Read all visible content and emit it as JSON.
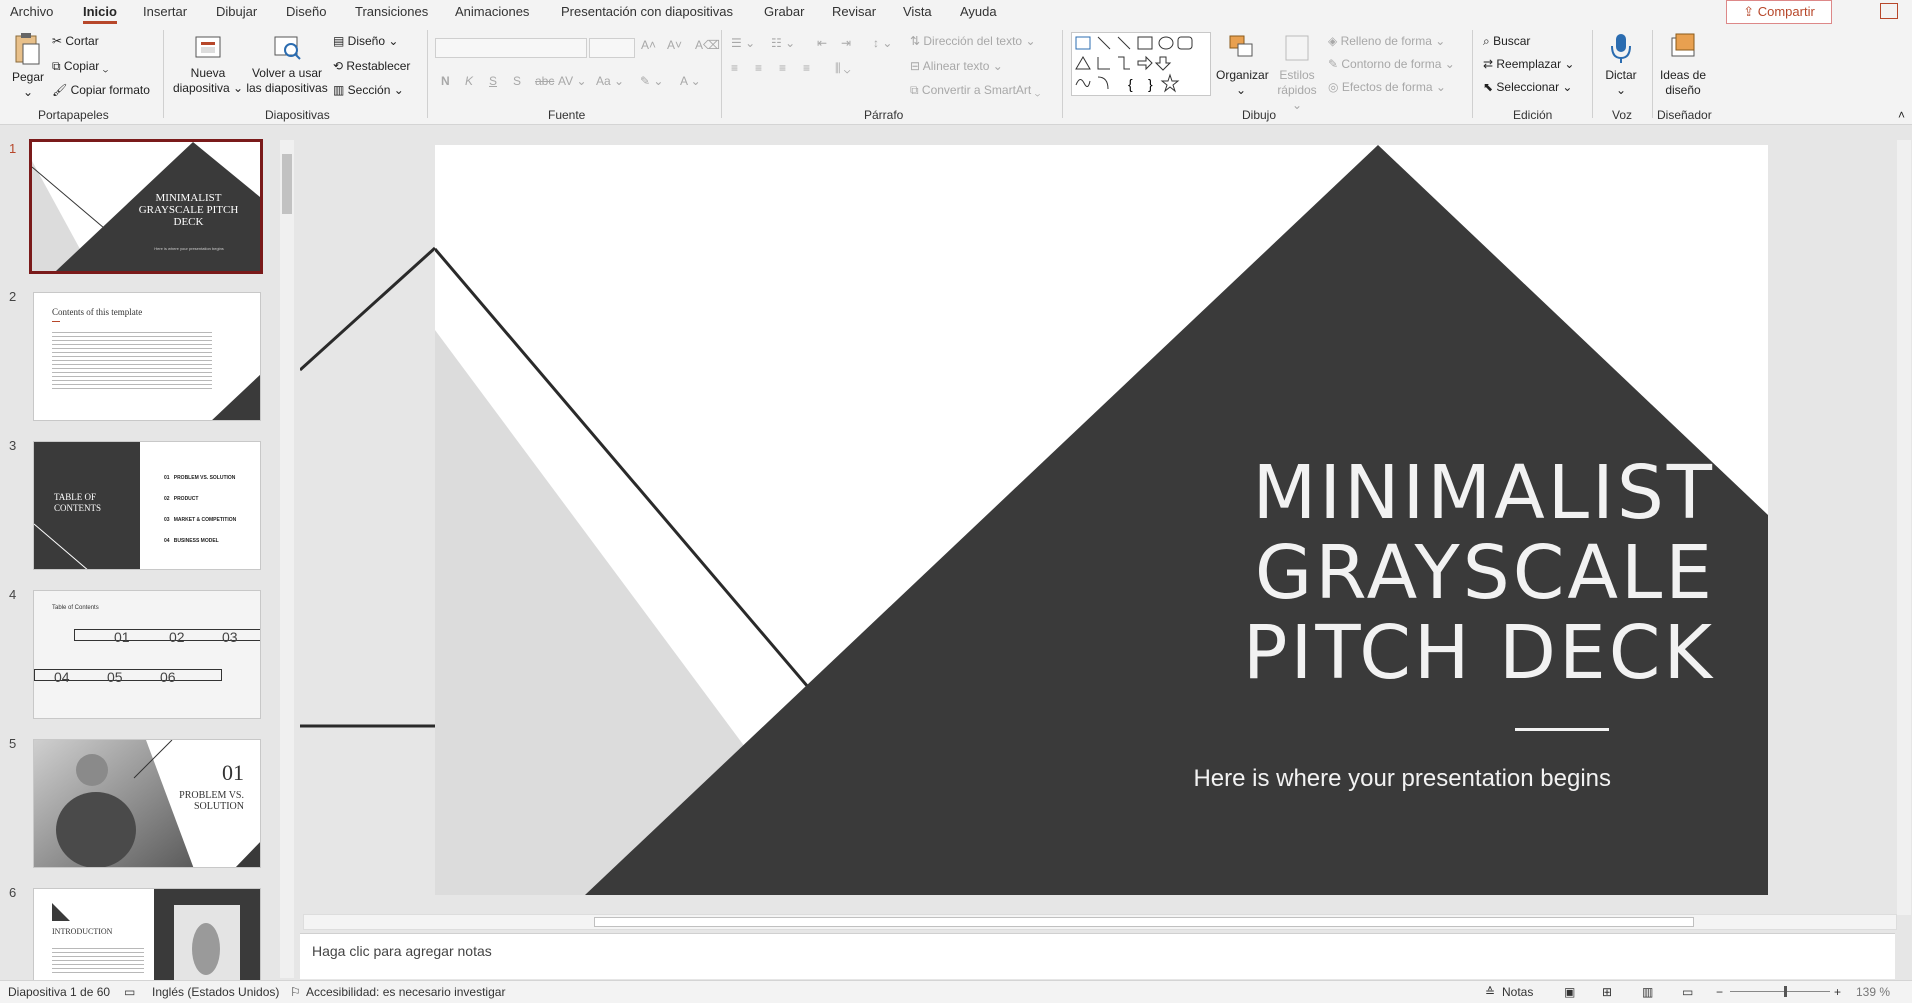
{
  "menu": {
    "tabs": [
      "Archivo",
      "Inicio",
      "Insertar",
      "Dibujar",
      "Diseño",
      "Transiciones",
      "Animaciones",
      "Presentación con diapositivas",
      "Grabar",
      "Revisar",
      "Vista",
      "Ayuda"
    ],
    "share_label": "Compartir"
  },
  "ribbon": {
    "clipboard": {
      "paste": "Pegar",
      "cut": "Cortar",
      "copy": "Copiar",
      "format_painter": "Copiar formato",
      "group": "Portapapeles"
    },
    "slides": {
      "new_slide_1": "Nueva",
      "new_slide_2": "diapositiva",
      "reuse_1": "Volver a usar",
      "reuse_2": "las diapositivas",
      "layout": "Diseño",
      "reset": "Restablecer",
      "section": "Sección",
      "group": "Diapositivas"
    },
    "font": {
      "group": "Fuente",
      "bold": "N",
      "italic": "K",
      "underline": "S",
      "shadow": "S",
      "strike": "abc",
      "spacing": "AV",
      "case": "Aa"
    },
    "paragraph": {
      "group": "Párrafo",
      "text_direction": "Dirección del texto",
      "align_text": "Alinear texto",
      "smartart": "Convertir a SmartArt"
    },
    "drawing": {
      "group": "Dibujo",
      "arrange": "Organizar",
      "quick_styles_1": "Estilos",
      "quick_styles_2": "rápidos",
      "shape_fill": "Relleno de forma",
      "shape_outline": "Contorno de forma",
      "shape_effects": "Efectos de forma"
    },
    "editing": {
      "group": "Edición",
      "find": "Buscar",
      "replace": "Reemplazar",
      "select": "Seleccionar"
    },
    "voice": {
      "group": "Voz",
      "dictate": "Dictar"
    },
    "designer": {
      "group": "Diseñador",
      "ideas_1": "Ideas de",
      "ideas_2": "diseño"
    }
  },
  "thumbnails": {
    "numbers": [
      "1",
      "2",
      "3",
      "4",
      "5",
      "6"
    ],
    "t1": {
      "title": "MINIMALIST GRAYSCALE PITCH DECK",
      "sub": "Here is where your presentation begins"
    },
    "t2": {
      "title": "Contents of this template"
    },
    "t3": {
      "title": "Table of contents",
      "items": [
        "PROBLEM VS. SOLUTION",
        "PRODUCT",
        "MARKET & COMPETITION",
        "BUSINESS MODEL"
      ],
      "nums": [
        "01",
        "02",
        "03",
        "04"
      ]
    },
    "t4": {
      "title": "Table of Contents",
      "nums": [
        "01",
        "02",
        "03",
        "04",
        "05",
        "06"
      ]
    },
    "t5": {
      "num": "01",
      "title": "Problem vs. solution"
    },
    "t6": {
      "title": "Introduction"
    }
  },
  "slide": {
    "title_line1": "MINIMALIST",
    "title_line2": "GRAYSCALE",
    "title_line3": "PITCH DECK",
    "subtitle": "Here is where your presentation begins"
  },
  "notes": {
    "placeholder": "Haga clic para agregar notas"
  },
  "status": {
    "slide_counter": "Diapositiva 1 de 60",
    "language": "Inglés (Estados Unidos)",
    "accessibility": "Accesibilidad: es necesario investigar",
    "notes_button": "Notas",
    "zoom": "139 %"
  },
  "colors": {
    "accent": "#b7472a",
    "dark": "#3a3a3a",
    "light_gray": "#dcdcdc"
  }
}
